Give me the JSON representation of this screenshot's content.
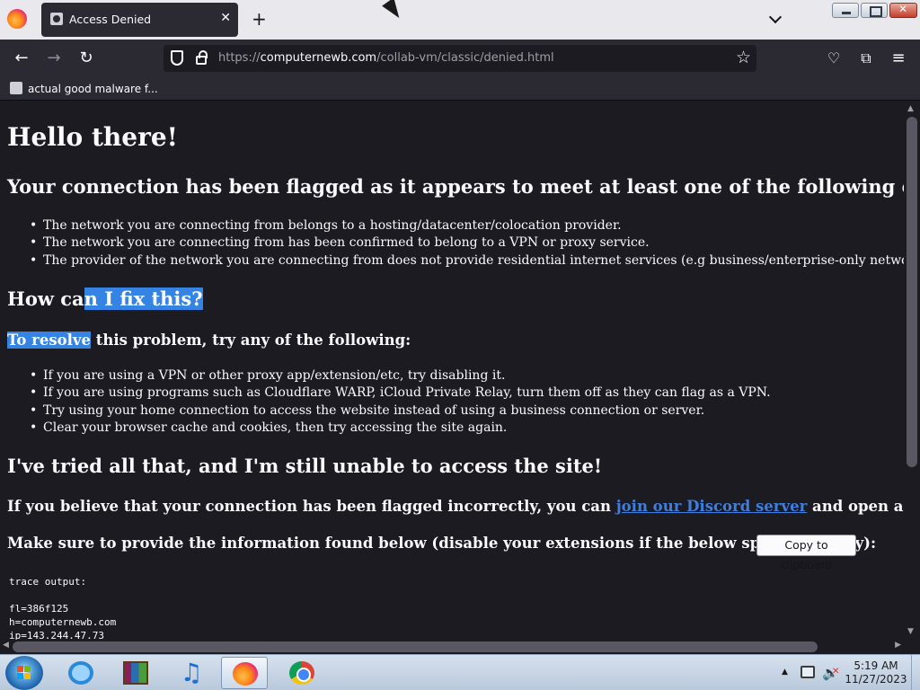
{
  "browser": {
    "tab_title": "Access Denied",
    "tab_close": "✕",
    "new_tab": "+",
    "url_prefix": "https://",
    "url_host": "computernewb.com",
    "url_path": "/collab-vm/classic/denied.html",
    "bookmark": "actual good malware f..."
  },
  "page": {
    "h1": "Hello there!",
    "criteria_heading": "Your connection has been flagged as it appears to meet at least one of the following criteria:",
    "criteria": [
      "The network you are connecting from belongs to a hosting/datacenter/colocation provider.",
      "The network you are connecting from has been confirmed to belong to a VPN or proxy service.",
      "The provider of the network you are connecting from does not provide residential internet services (e.g business/enterprise-only networks)."
    ],
    "fix_heading_pre": "How ca",
    "fix_heading_sel": "n I fix this?",
    "resolve_sel": "To resolve",
    "resolve_rest": " this problem, try any of the following:",
    "fixes": [
      "If you are using a VPN or other proxy app/extension/etc, try disabling it.",
      "If you are using programs such as Cloudflare WARP, iCloud Private Relay, turn them off as they can flag as a VPN.",
      "Try using your home connection to access the website instead of using a business connection or server.",
      "Clear your browser cache and cookies, then try accessing the site again."
    ],
    "tried_heading": "I've tried all that, and I'm still unable to access the site!",
    "believe_pre": "If you believe that your connection has been flagged incorrectly, you can ",
    "discord_link": "join our Discord server",
    "believe_post": " and open a ticket.",
    "provide_text": "Make sure to provide the information found below (disable your extensions if the below space is empty):",
    "copy_button": "Copy to clipboard",
    "trace_lines": [
      "trace output:",
      "",
      "fl=386f125",
      "h=computernewb.com",
      "ip=143.244.47.73"
    ]
  },
  "taskbar": {
    "time": "5:19 AM",
    "date": "11/27/2023"
  }
}
